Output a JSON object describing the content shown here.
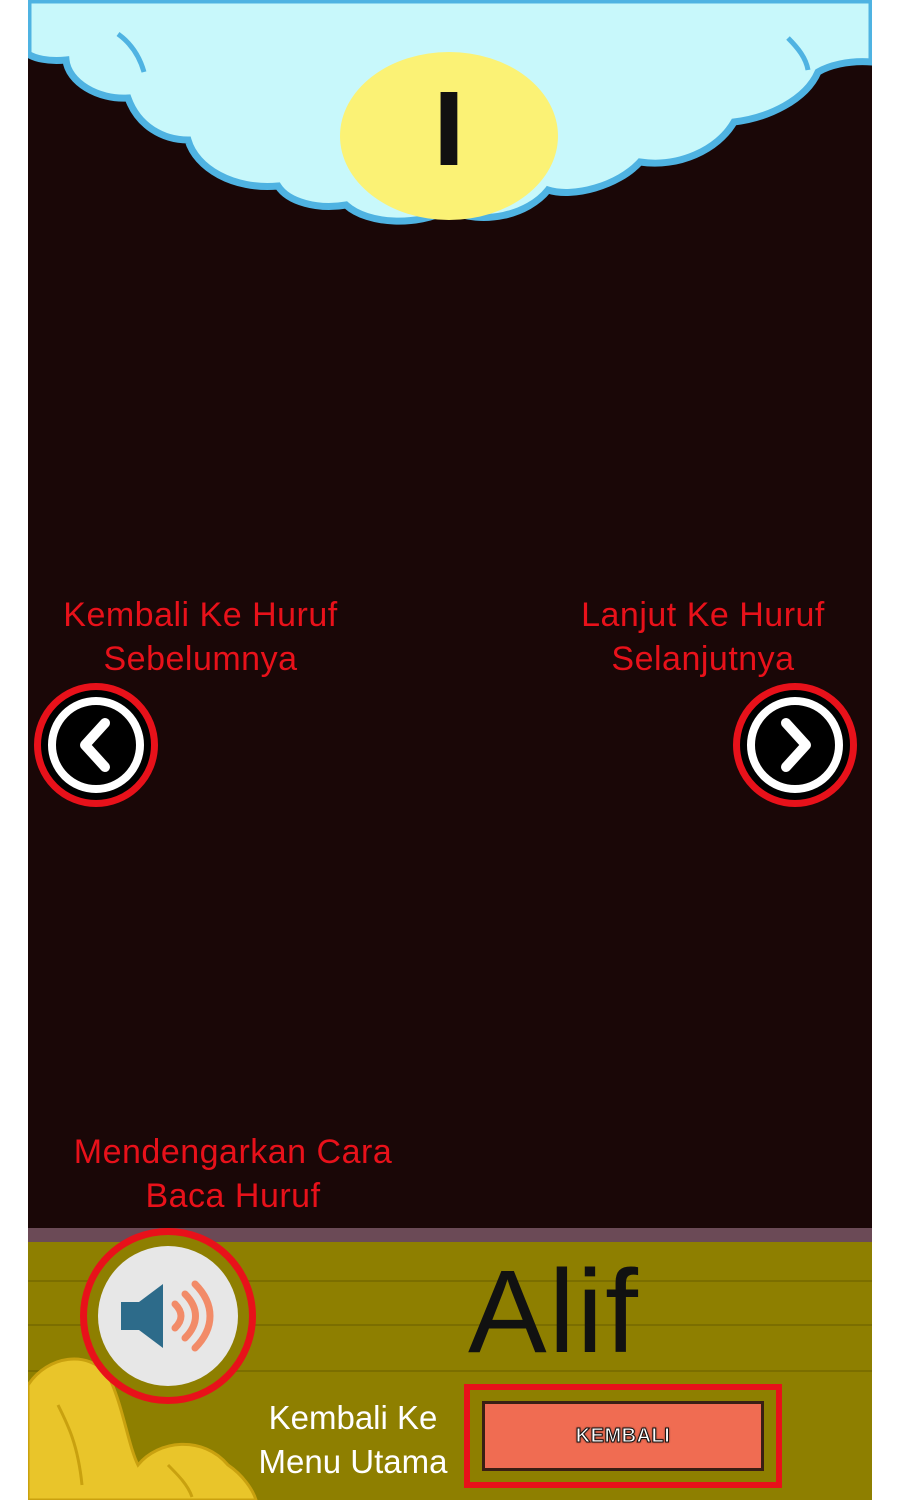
{
  "header": {
    "letter": "ا"
  },
  "hints": {
    "prev": "Kembali Ke Huruf Sebelumnya",
    "next": "Lanjut Ke Huruf Selanjutnya",
    "sound": "Mendengarkan Cara Baca Huruf",
    "menu": "Kembali Ke Menu Utama"
  },
  "letter_name": "Alif",
  "buttons": {
    "back_label": "KEMBALI"
  },
  "icons": {
    "prev": "chevron-left-icon",
    "next": "chevron-right-icon",
    "sound": "speaker-icon"
  },
  "colors": {
    "background": "#1a0707",
    "sky": "#c8f8fb",
    "cloud_outline": "#4fb3e2",
    "highlight": "#e8111a",
    "ground": "#8e7f00",
    "back_button": "#f06c52"
  }
}
